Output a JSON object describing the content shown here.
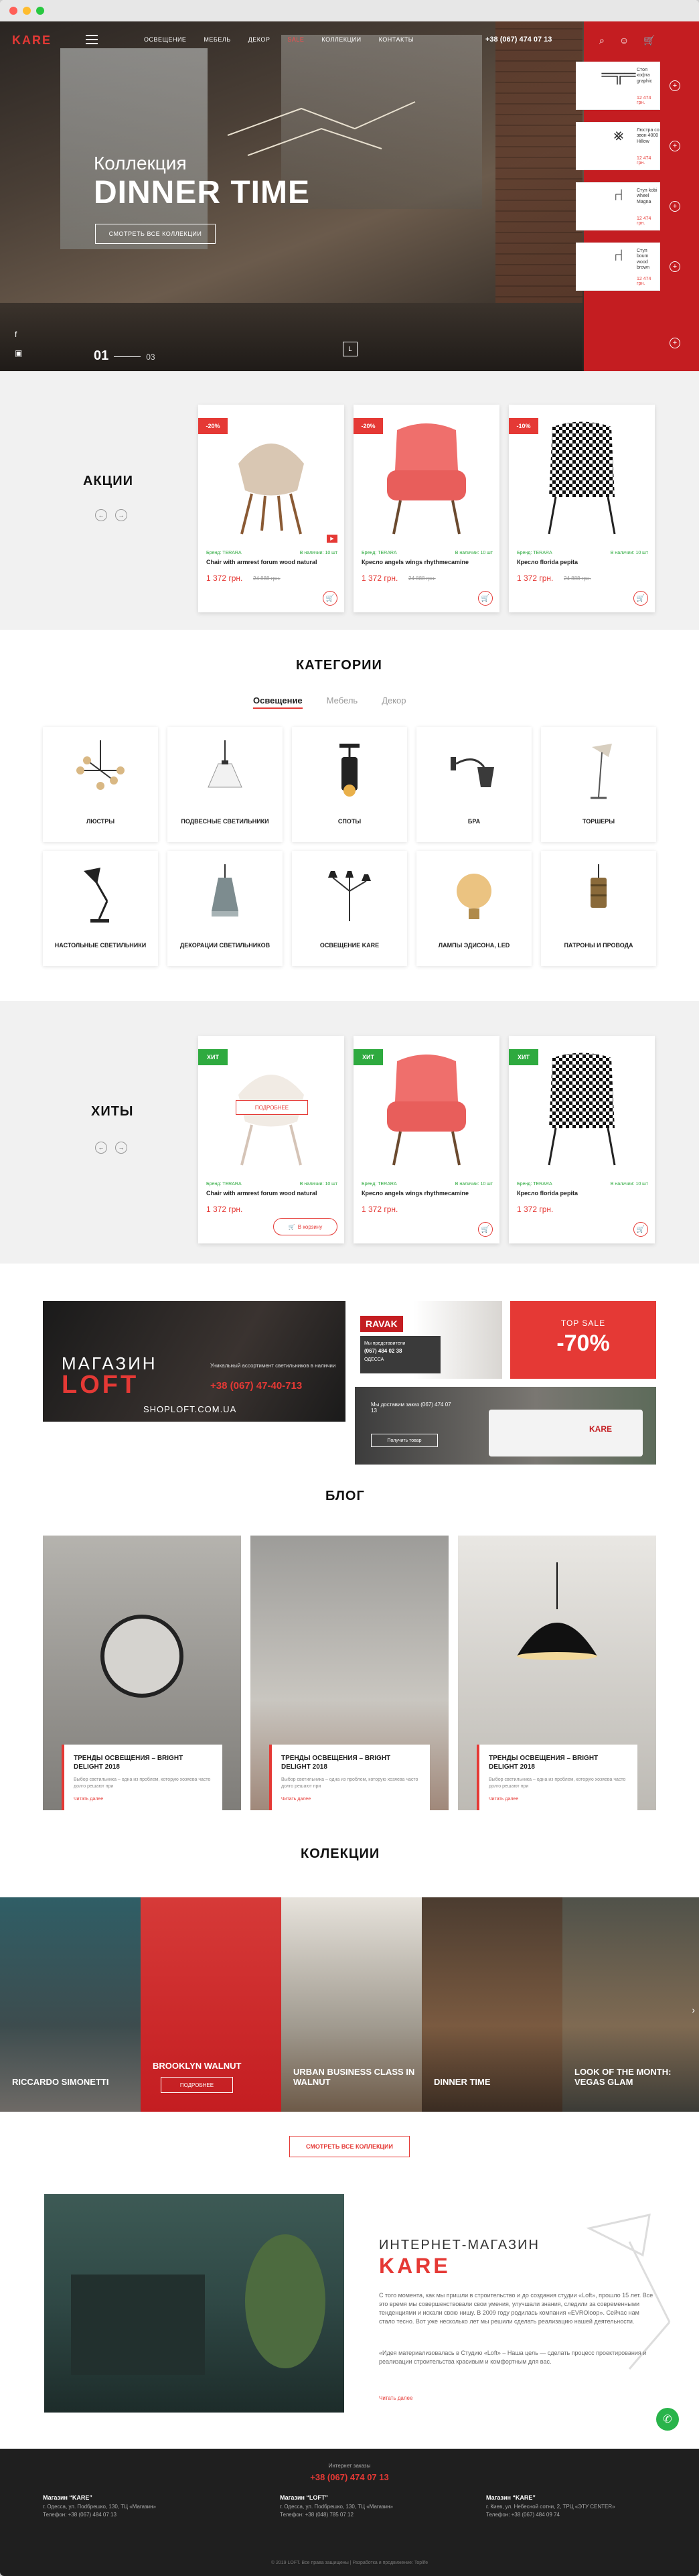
{
  "header": {
    "logo": "KARE",
    "nav": [
      "ОСВЕЩЕНИЕ",
      "МЕБЕЛЬ",
      "ДЕКОР",
      "SALE",
      "КОЛЛЕКЦИИ",
      "КОНТАКТЫ"
    ],
    "phone": "+38 (067) 474 07 13",
    "cart_count": "0"
  },
  "hero": {
    "subtitle": "Коллекция",
    "title": "DINNER TIME",
    "button": "СМОТРЕТЬ ВСЕ КОЛЛЕКЦИИ",
    "page_current": "01",
    "page_total": "03",
    "products": [
      {
        "name": "Стол кофта graphic",
        "price": "12 474 грн."
      },
      {
        "name": "Люстра со звон 4000 Hillow",
        "price": "12 474 грн."
      },
      {
        "name": "Стул kobi wheel Magna",
        "price": "12 474 грн."
      },
      {
        "name": "Стул boum wood brown",
        "price": "12 474 грн."
      }
    ]
  },
  "sales": {
    "title": "АКЦИИ",
    "items": [
      {
        "badge": "-20%",
        "brand": "Бренд: TERARA",
        "stock": "В наличии: 10 шт",
        "name": "Chair with armrest forum wood natural",
        "price": "1 372 грн.",
        "old": "24 888 грн."
      },
      {
        "badge": "-20%",
        "brand": "Бренд: TERARA",
        "stock": "В наличии: 10 шт",
        "name": "Кресло angels wings rhythmecamine",
        "price": "1 372 грн.",
        "old": "24 888 грн."
      },
      {
        "badge": "-10%",
        "brand": "Бренд: TERARA",
        "stock": "В наличии: 10 шт",
        "name": "Кресло florida pepita",
        "price": "1 372 грн.",
        "old": "24 888 грн."
      }
    ]
  },
  "categories": {
    "title": "КАТЕГОРИИ",
    "tabs": [
      "Освещение",
      "Мебель",
      "Декор"
    ],
    "items": [
      "ЛЮСТРЫ",
      "ПОДВЕСНЫЕ СВЕТИЛЬНИКИ",
      "СПОТЫ",
      "БРА",
      "ТОРШЕРЫ",
      "НАСТОЛЬНЫЕ СВЕТИЛЬНИКИ",
      "ДЕКОРАЦИИ СВЕТИЛЬНИКОВ",
      "ОСВЕЩЕНИЕ KARE",
      "ЛАМПЫ ЭДИСОНА, LED",
      "ПАТРОНЫ И ПРОВОДА"
    ]
  },
  "hits": {
    "title": "ХИТЫ",
    "badge": "ХИТ",
    "more": "ПОДРОБНЕЕ",
    "to_cart": "В корзину",
    "items": [
      {
        "brand": "Бренд: TERARA",
        "stock": "В наличии: 10 шт",
        "name": "Chair with armrest forum wood natural",
        "price": "1 372 грн."
      },
      {
        "brand": "Бренд: TERARA",
        "stock": "В наличии: 10 шт",
        "name": "Кресло angels wings rhythmecamine",
        "price": "1 372 грн."
      },
      {
        "brand": "Бренд: TERARA",
        "stock": "В наличии: 10 шт",
        "name": "Кресло florida pepita",
        "price": "1 372 грн."
      }
    ]
  },
  "promos": {
    "loft_title": "МАГАЗИН",
    "loft_word": "LOFT",
    "loft_text": "Уникальный ассортимент светильников в наличии",
    "loft_phone": "+38 (067) 47-40-713",
    "loft_site": "SHOPLOFT.COM.UA",
    "ravak": "RAVAK",
    "ravak_sub": "Мы представители",
    "ravak_phone": "(067) 484 02 38",
    "ravak_city": "ОДЕССА",
    "sale_label": "TOP SALE",
    "sale_value": "-70%",
    "delivery_text": "Мы доставим заказ (067) 474 07 13",
    "delivery_btn": "Получить товар",
    "truck_logo": "KARE"
  },
  "blog": {
    "title": "БЛОГ",
    "items": [
      {
        "title": "ТРЕНДЫ ОСВЕЩЕНИЯ – BRIGHT DELIGHT 2018",
        "text": "Выбор светильника – одна из проблем, которую хозяева часто долго решают при",
        "more": "Читать далее"
      },
      {
        "title": "ТРЕНДЫ ОСВЕЩЕНИЯ – BRIGHT DELIGHT 2018",
        "text": "Выбор светильника – одна из проблем, которую хозяева часто долго решают при",
        "more": "Читать далее"
      },
      {
        "title": "ТРЕНДЫ ОСВЕЩЕНИЯ – BRIGHT DELIGHT 2018",
        "text": "Выбор светильника – одна из проблем, которую хозяева часто долго решают при",
        "more": "Читать далее"
      }
    ]
  },
  "collections": {
    "title": "КОЛЕКЦИИ",
    "button": "ПОДРОБНЕЕ",
    "all_button": "СМОТРЕТЬ ВСЕ КОЛЛЕКЦИИ",
    "items": [
      "RICCARDO SIMONETTI",
      "BROOKLYN WALNUT",
      "URBAN BUSINESS CLASS IN WALNUT",
      "DINNER TIME",
      "LOOK OF THE MONTH: VEGAS GLAM"
    ]
  },
  "about": {
    "title1": "ИНТЕРНЕТ-МАГАЗИН",
    "title2": "KARE",
    "p1": "С того момента, как мы пришли в строительство и до создания студии «Loft», прошло 15 лет. Все это время мы совершенствовали свои умения, улучшали знания, следили за современными тенденциями и искали свою нишу. В 2009 году родилась компания «EVROloop». Сейчас нам стало тесно. Вот уже несколько лет мы решили сделать реализацию нашей деятельности.",
    "p2": "«Идея материализовалась в Студию «Loft» – Наша цель — сделать процесс проектирования и реализации строительства красивым и комфортным для вас.",
    "more": "Читать далее"
  },
  "footer": {
    "order_label": "Интернет заказы",
    "order_phone": "+38 (067) 474 07 13",
    "cols": [
      {
        "title": "Магазин “KARE”",
        "addr": "г. Одесса, ул. Пodбрешко, 130, ТЦ «Магазин»",
        "phone": "Телефон: +38 (067) 484 07 13"
      },
      {
        "title": "Магазин “LOFT”",
        "addr": "г. Одесса, ул. Пodбрешко, 130, ТЦ «Магазин»",
        "phone": "Телефон: +38 (048) 785 07 12"
      },
      {
        "title": "Магазин “KARE”",
        "addr": "г. Киев, ул. Небесной сотни, 2, ТРЦ «ЭТУ CENTER»",
        "phone": "Телефон: +38 (067) 484 09 74"
      }
    ],
    "copyright": "© 2019 LOFT. Все права защищены | Разработка и продвижение: Toplife"
  },
  "colors": {
    "accent": "#e53935",
    "green": "#2eaa3f",
    "footer": "#1f1f1f"
  }
}
